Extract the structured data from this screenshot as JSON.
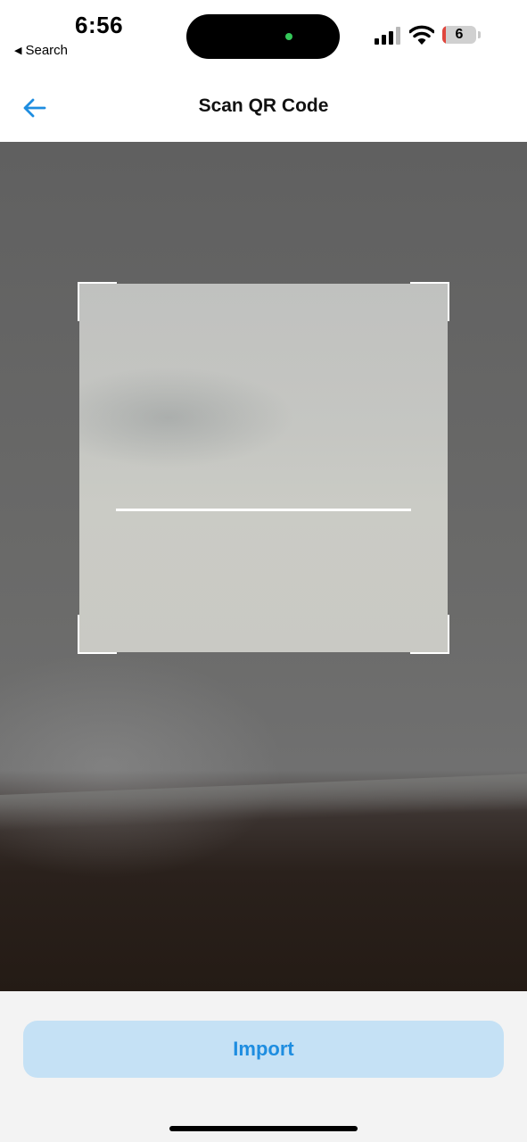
{
  "status_bar": {
    "time": "6:56",
    "back_to_app_label": "Search",
    "battery_level": "6",
    "battery_color": "#e0463d",
    "signal_icon": "cellular-signal-icon",
    "wifi_icon": "wifi-icon"
  },
  "nav": {
    "title": "Scan QR Code",
    "back_icon": "arrow-left-icon",
    "accent_color": "#1e8de0"
  },
  "scanner": {
    "frame_color": "#ffffff",
    "scan_line_color": "#ffffff"
  },
  "actions": {
    "import_label": "Import",
    "import_bg": "#c5e1f5",
    "import_text_color": "#1e8de0"
  }
}
